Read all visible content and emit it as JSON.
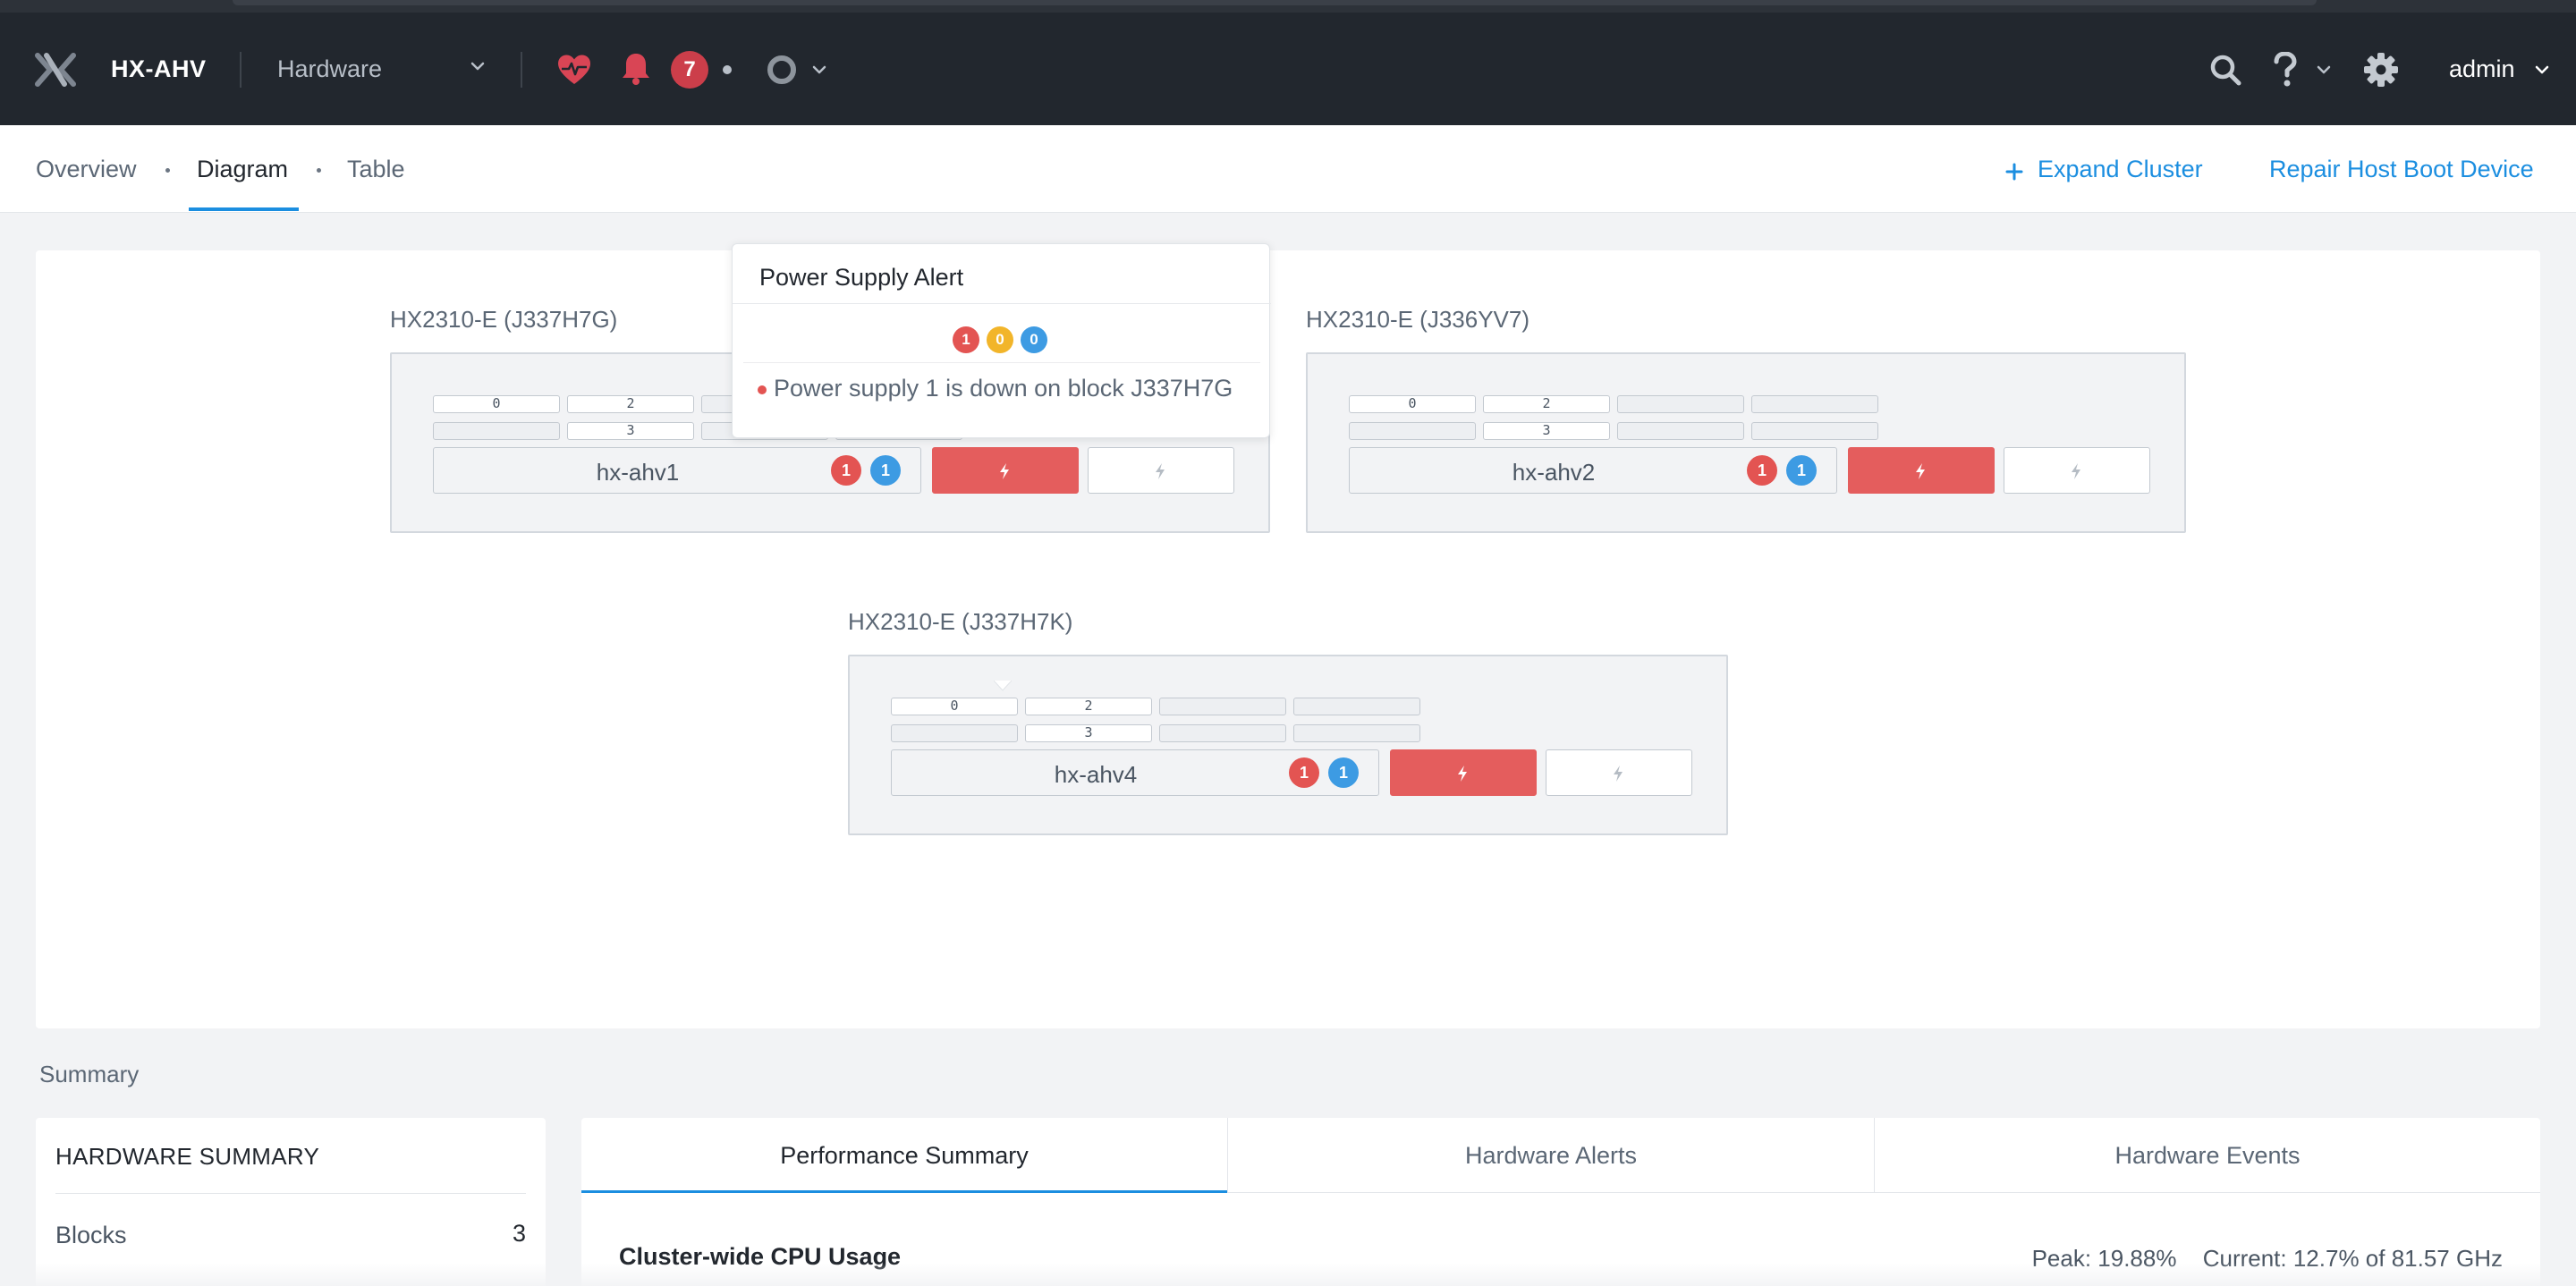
{
  "header": {
    "cluster_name": "HX-AHV",
    "breadcrumb": "Hardware",
    "alert_count": "7",
    "user": "admin"
  },
  "tabs": [
    {
      "label": "Overview"
    },
    {
      "label": "Diagram",
      "active": true
    },
    {
      "label": "Table"
    }
  ],
  "actions": {
    "expand_cluster": "Expand Cluster",
    "repair_host": "Repair Host Boot Device"
  },
  "blocks": [
    {
      "title": "HX2310-E (J337H7G)",
      "slots_top": [
        "0",
        "2",
        "",
        ""
      ],
      "slots_bottom": [
        "",
        "3",
        "",
        ""
      ],
      "host": "hx-ahv1",
      "badge_red": "1",
      "badge_blue": "1"
    },
    {
      "title": "HX2310-E (J336YV7)",
      "slots_top": [
        "0",
        "2",
        "",
        ""
      ],
      "slots_bottom": [
        "",
        "3",
        "",
        ""
      ],
      "host": "hx-ahv2",
      "badge_red": "1",
      "badge_blue": "1"
    },
    {
      "title": "HX2310-E (J337H7K)",
      "slots_top": [
        "0",
        "2",
        "",
        ""
      ],
      "slots_bottom": [
        "",
        "3",
        "",
        ""
      ],
      "host": "hx-ahv4",
      "badge_red": "1",
      "badge_blue": "1"
    }
  ],
  "popover": {
    "title": "Power Supply Alert",
    "critical": "1",
    "warning": "0",
    "info": "0",
    "message": "Power supply 1 is down on block J337H7G"
  },
  "summary": {
    "section_label": "Summary",
    "hardware_summary": {
      "title": "HARDWARE SUMMARY",
      "rows": [
        {
          "label": "Blocks",
          "value": "3"
        }
      ]
    },
    "perf_tabs": [
      "Performance Summary",
      "Hardware Alerts",
      "Hardware Events"
    ],
    "cpu": {
      "title": "Cluster-wide CPU Usage",
      "peak": "Peak: 19.88%",
      "current": "Current: 12.7% of 81.57 GHz"
    }
  },
  "colors": {
    "accent": "#1b8ee0",
    "critical": "#e35452",
    "warning": "#f2b52a",
    "info": "#3d9be3",
    "header_bg": "#22272e"
  }
}
